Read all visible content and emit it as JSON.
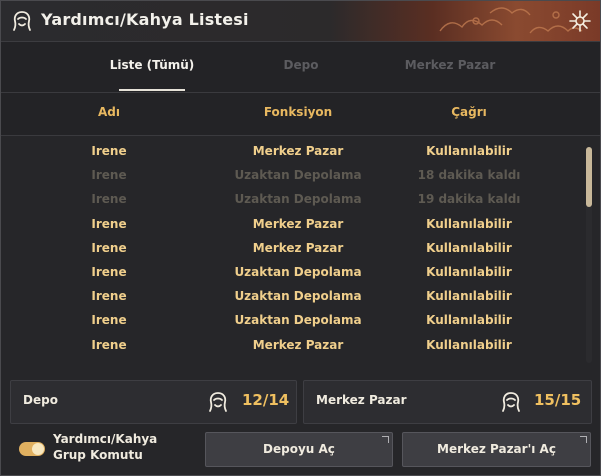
{
  "window": {
    "title": "Yardımcı/Kahya Listesi"
  },
  "tabs": [
    {
      "label": "Liste (Tümü)",
      "active": true
    },
    {
      "label": "Depo",
      "active": false
    },
    {
      "label": "Merkez Pazar",
      "active": false
    }
  ],
  "columns": {
    "name": "Adı",
    "function": "Fonksiyon",
    "call": "Çağrı"
  },
  "rows": [
    {
      "name": "Irene",
      "function": "Merkez Pazar",
      "call": "Kullanılabilir",
      "available": true
    },
    {
      "name": "Irene",
      "function": "Uzaktan Depolama",
      "call": "18 dakika kaldı",
      "available": false
    },
    {
      "name": "Irene",
      "function": "Uzaktan Depolama",
      "call": "19 dakika kaldı",
      "available": false
    },
    {
      "name": "Irene",
      "function": "Merkez Pazar",
      "call": "Kullanılabilir",
      "available": true
    },
    {
      "name": "Irene",
      "function": "Merkez Pazar",
      "call": "Kullanılabilir",
      "available": true
    },
    {
      "name": "Irene",
      "function": "Uzaktan Depolama",
      "call": "Kullanılabilir",
      "available": true
    },
    {
      "name": "Irene",
      "function": "Uzaktan Depolama",
      "call": "Kullanılabilir",
      "available": true
    },
    {
      "name": "Irene",
      "function": "Uzaktan Depolama",
      "call": "Kullanılabilir",
      "available": true
    },
    {
      "name": "Irene",
      "function": "Merkez Pazar",
      "call": "Kullanılabilir",
      "available": true
    }
  ],
  "counters": {
    "depo": {
      "label": "Depo",
      "value": "12/14",
      "icon": "helper-head-icon"
    },
    "market": {
      "label": "Merkez Pazar",
      "value": "15/15",
      "icon": "helper-head-icon"
    }
  },
  "footer": {
    "toggle_label": "Yardımcı/Kahya Grup Komutu",
    "toggle_on": true,
    "open_storage": "Depoyu Aç",
    "open_market": "Merkez Pazar'ı Aç"
  },
  "colors": {
    "accent": "#f0c060",
    "available_text": "#f0cf8c",
    "unavailable_text": "#5e5a52",
    "header_text": "#e8b860"
  }
}
